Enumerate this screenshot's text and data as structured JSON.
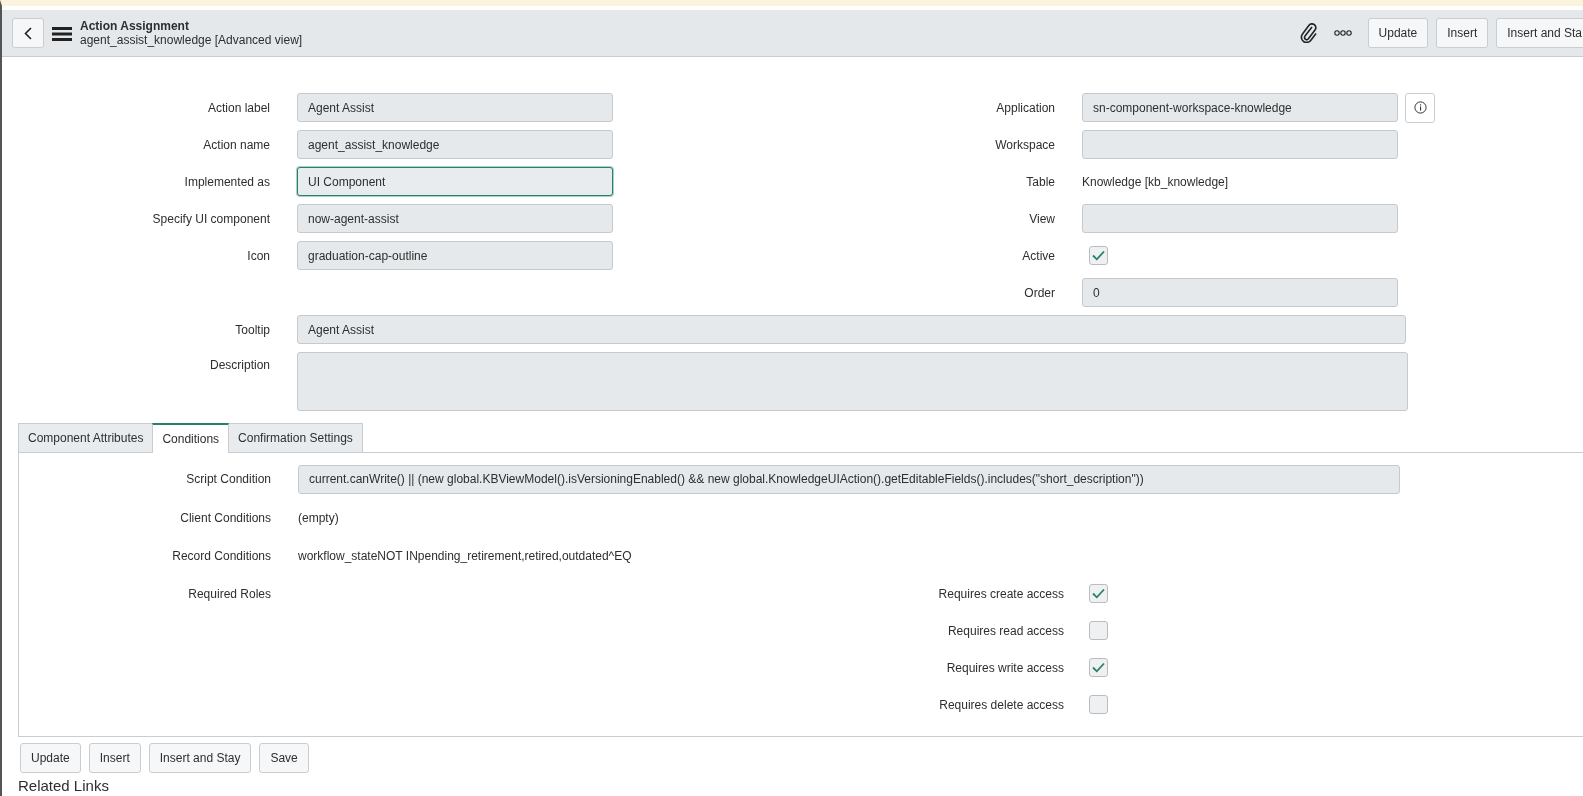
{
  "header": {
    "title": "Action Assignment",
    "subtitle": "agent_assist_knowledge [Advanced view]",
    "buttons": [
      "Update",
      "Insert",
      "Insert and Sta"
    ]
  },
  "form": {
    "left": [
      {
        "label": "Action label",
        "kind": "field",
        "value": "Agent Assist",
        "focused": false
      },
      {
        "label": "Action name",
        "kind": "field",
        "value": "agent_assist_knowledge",
        "focused": false
      },
      {
        "label": "Implemented as",
        "kind": "field",
        "value": "UI Component",
        "focused": true
      },
      {
        "label": "Specify UI component",
        "kind": "field",
        "value": "now-agent-assist",
        "focused": false
      },
      {
        "label": "Icon",
        "kind": "field",
        "value": "graduation-cap-outline",
        "focused": false
      }
    ],
    "right": [
      {
        "label": "Application",
        "kind": "field_info",
        "value": "sn-component-workspace-knowledge",
        "focused": false
      },
      {
        "label": "Workspace",
        "kind": "field",
        "focused": false
      },
      {
        "label": "Table",
        "kind": "text",
        "value": "Knowledge [kb_knowledge]"
      },
      {
        "label": "View",
        "kind": "field",
        "focused": false
      },
      {
        "label": "Active",
        "kind": "checkbox",
        "checked": true
      },
      {
        "label": "Order",
        "kind": "field",
        "value": "0",
        "focused": false
      }
    ],
    "tooltip": {
      "label": "Tooltip",
      "value": "Agent Assist"
    },
    "description": {
      "label": "Description"
    }
  },
  "tabs": [
    {
      "label": "Component Attributes",
      "selected": false
    },
    {
      "label": "Conditions",
      "selected": true
    },
    {
      "label": "Confirmation Settings",
      "selected": false
    }
  ],
  "conditions": {
    "rows": [
      {
        "label": "Script Condition",
        "kind": "field",
        "value": "current.canWrite() || (new global.KBViewModel().isVersioningEnabled() && new global.KnowledgeUIAction().getEditableFields().includes(\"short_description\"))"
      },
      {
        "label": "Client Conditions",
        "kind": "text",
        "value": "(empty)"
      },
      {
        "label": "Record Conditions",
        "kind": "text",
        "value": "workflow_stateNOT INpending_retirement,retired,outdated^EQ"
      },
      {
        "label": "Required Roles",
        "kind": "text"
      }
    ],
    "access": [
      {
        "label": "Requires create access",
        "checked": true
      },
      {
        "label": "Requires read access",
        "checked": false
      },
      {
        "label": "Requires write access",
        "checked": true
      },
      {
        "label": "Requires delete access",
        "checked": false
      }
    ]
  },
  "footer_buttons": [
    "Update",
    "Insert",
    "Insert and Stay",
    "Save"
  ],
  "related_links": "Related Links"
}
